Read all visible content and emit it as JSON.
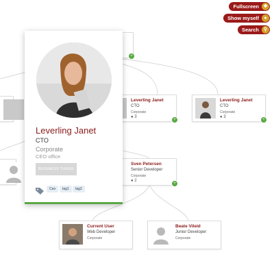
{
  "toolbar": {
    "fullscreen_label": "Fullscreen",
    "show_myself_label": "Show myself",
    "search_label": "Search"
  },
  "detail_card": {
    "name": "Leverling Janet",
    "title": "CTO",
    "department": "Corporate",
    "office": "CEO office",
    "button_label": "BUSINESS THREE",
    "tags": [
      "Ceo",
      "tag1",
      "tag2"
    ]
  },
  "nodes": {
    "top_partial": {
      "name": "",
      "title": ""
    },
    "lj_left": {
      "name": "Leverling Janet",
      "title": "CTO",
      "dept": "Corporate",
      "count": "3"
    },
    "lj_right": {
      "name": "Leverling Janet",
      "title": "CTO",
      "dept": "Corporate",
      "count": "3"
    },
    "sven": {
      "name": "Sven Petersen",
      "title": "Senior Developer",
      "dept": "Corporate",
      "count": "2"
    },
    "current_user": {
      "name": "Current User",
      "title": "Web Developer",
      "dept": "Corporate"
    },
    "beate": {
      "name": "Beate Vileid",
      "title": "Junior Developer",
      "dept": "Corporate"
    }
  },
  "colors": {
    "brand_red": "#9b1a1a",
    "name_red": "#8b1a1a",
    "accent_gold": "#d4a12a",
    "expand_green": "#5aa845"
  },
  "icons": [
    "expand-icon",
    "search-icon",
    "user-icon",
    "tag-icon",
    "plus-icon"
  ]
}
